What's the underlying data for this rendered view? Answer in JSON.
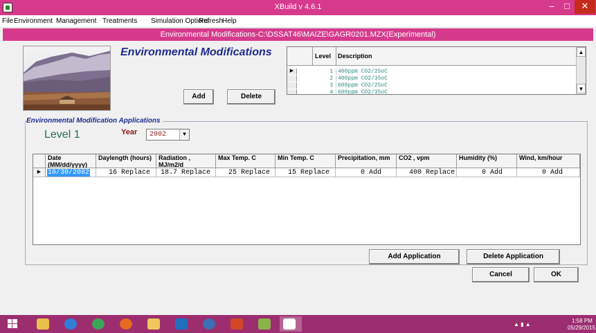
{
  "window": {
    "title": "XBuild v 4.6.1",
    "controls": {
      "minimize": "–",
      "maximize": "□",
      "close": "✕"
    }
  },
  "menu": {
    "items": [
      "File",
      "Environment",
      "Management",
      "Treatments",
      "Simulation Options",
      "Refresh",
      "Help"
    ]
  },
  "mdi": {
    "title": "Environmental Modifications-C:\\DSSAT46\\MAIZE\\GAGR0201.MZX(Experimental)"
  },
  "header": {
    "title": "Environmental Modifications",
    "add_label": "Add",
    "delete_label": "Delete"
  },
  "levels_grid": {
    "columns": [
      "Level",
      "Description"
    ],
    "rows": [
      {
        "level": "1",
        "description": "400ppm CO2/25oC"
      },
      {
        "level": "2",
        "description": "400ppm CO2/35oC"
      },
      {
        "level": "3",
        "description": "600ppm CO2/25oC"
      },
      {
        "level": "4",
        "description": "600ppm CO2/35oC"
      }
    ],
    "selected_marker": "▶",
    "scroll_up": "▲",
    "scroll_down": "▼"
  },
  "applications": {
    "group_label": "Environmental Modification Applications",
    "level_label": "Level 1",
    "year_label": "Year",
    "year_value": "2002",
    "dropdown_arrow": "▼",
    "columns": [
      "Date (MM/dd/yyyy)",
      "Daylength (hours)",
      "Radiation , MJ/m2/d",
      "Max Temp. C",
      "Min Temp. C",
      "Precipitation, mm",
      "CO2 , vpm",
      "Humidity (%)",
      "Wind, km/hour"
    ],
    "rows": [
      {
        "date": "10/30/2002",
        "daylength": "   16 Replace",
        "radiation": " 18.7 Replace",
        "max_temp": "   25 Replace",
        "min_temp": "   15 Replace",
        "precipitation": "      0 Add",
        "co2": "   400 Replace",
        "humidity": "      0 Add",
        "wind": "      0 Add"
      }
    ],
    "row_marker": "▶",
    "add_application_label": "Add Application",
    "delete_application_label": "Delete Application"
  },
  "footer": {
    "cancel_label": "Cancel",
    "ok_label": "OK"
  },
  "taskbar": {
    "time": "1:58 PM",
    "date": "05/29/2015"
  },
  "colors": {
    "titlebar": "#d63a8c",
    "taskbar": "#9c2e70",
    "heading": "#1f2b8f",
    "level_text": "#2b6b5a",
    "year_text": "#8a1a1a",
    "description_text": "#2d8a7d"
  }
}
